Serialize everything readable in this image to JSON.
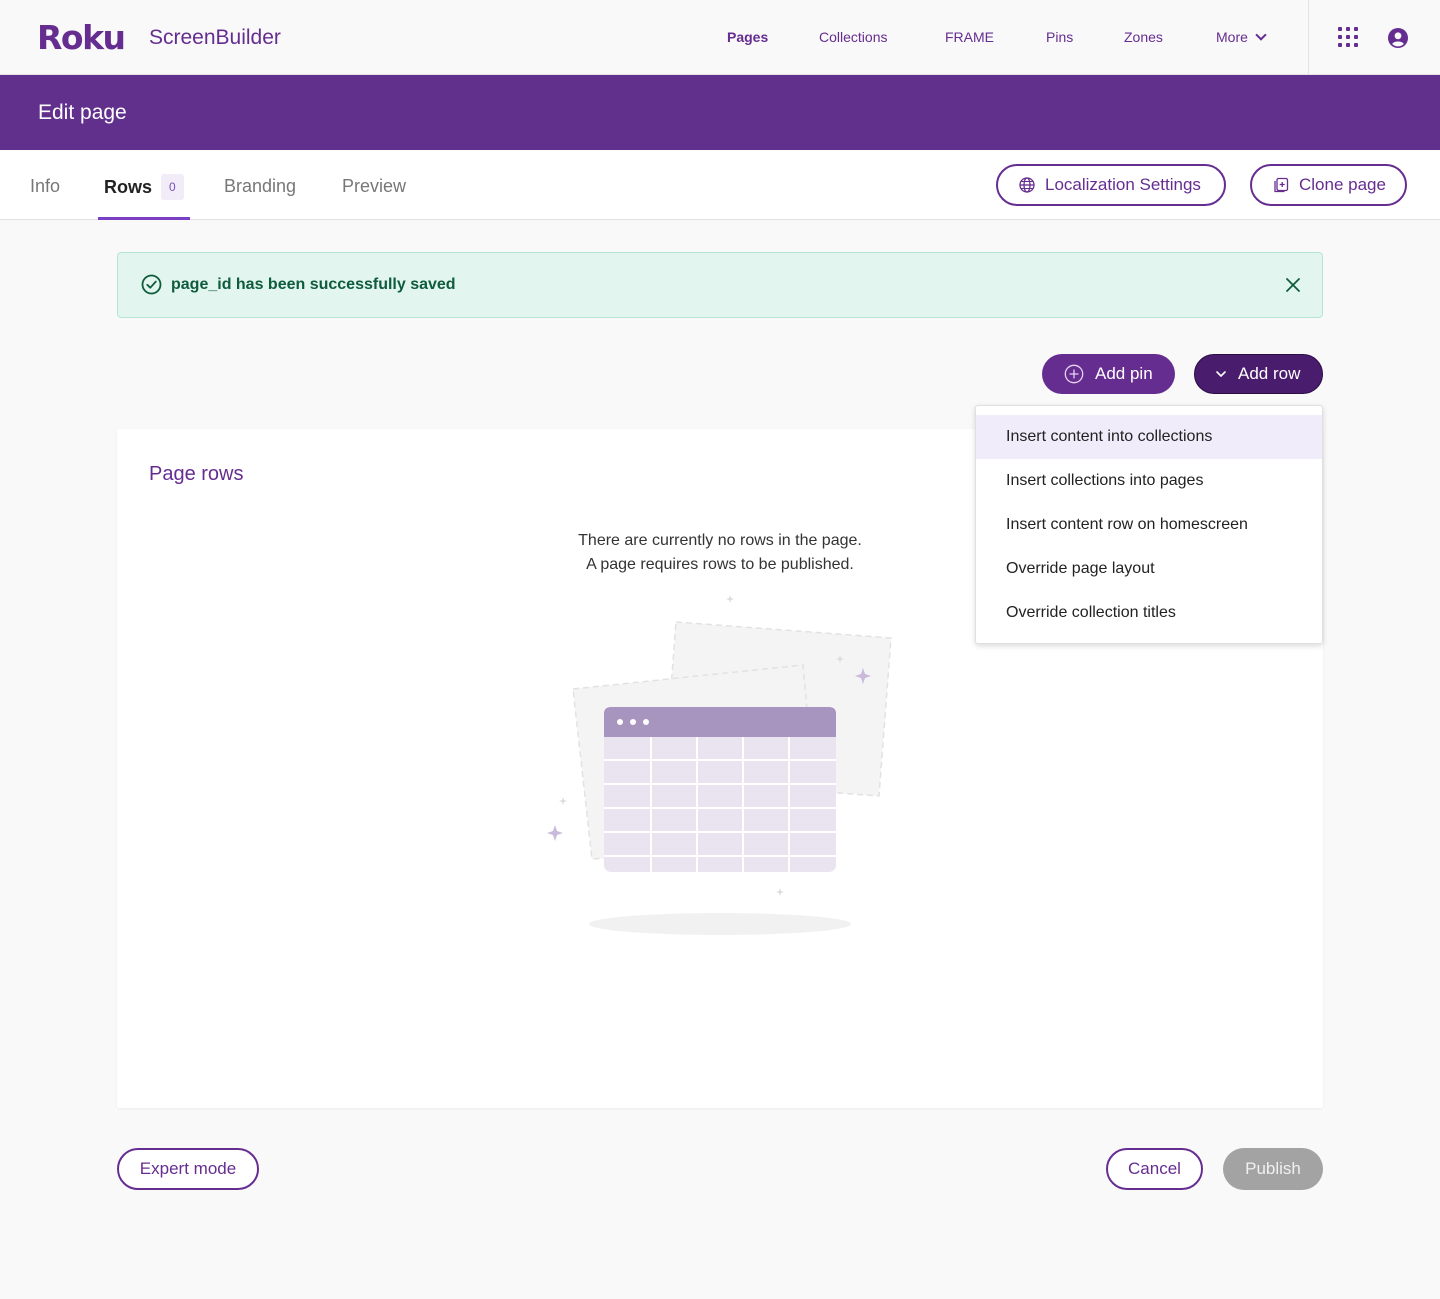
{
  "nav": {
    "logo": "Roku",
    "product": "ScreenBuilder",
    "links": [
      "Pages",
      "Collections",
      "FRAME",
      "Pins",
      "Zones",
      "More"
    ]
  },
  "header": {
    "title": "Edit page"
  },
  "tabs": [
    {
      "label": "Info"
    },
    {
      "label": "Rows",
      "badge": "0"
    },
    {
      "label": "Branding"
    },
    {
      "label": "Preview"
    }
  ],
  "actions": {
    "localization": "Localization Settings",
    "clone": "Clone page",
    "add_pin": "Add pin",
    "add_row": "Add row"
  },
  "alert": {
    "message": "page_id has been successfully saved"
  },
  "card": {
    "title": "Page rows",
    "empty_line1": "There are currently no rows in the page.",
    "empty_line2": "A page requires rows to be published."
  },
  "dropdown": {
    "items": [
      "Insert content into collections",
      "Insert collections into pages",
      "Insert content row on homescreen",
      "Override page layout",
      "Override collection titles"
    ]
  },
  "footer": {
    "expert": "Expert mode",
    "cancel": "Cancel",
    "publish": "Publish"
  },
  "colors": {
    "brand": "#662d91",
    "header": "#612f8c",
    "success_bg": "#e2f6ef",
    "success_text": "#0f5c3c",
    "disabled": "#a3a3a3"
  }
}
